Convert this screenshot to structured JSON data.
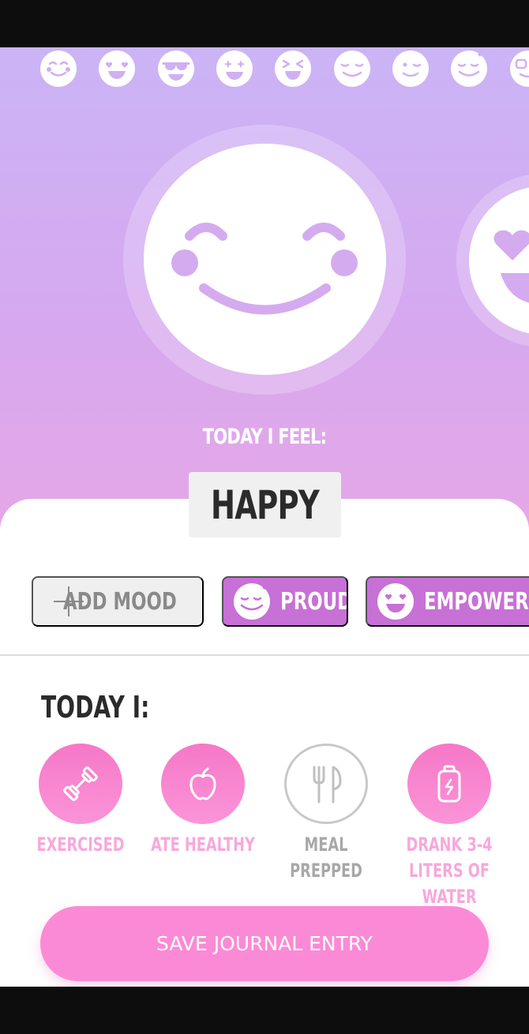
{
  "mood_strip": {
    "icons": [
      "smiling-face-icon",
      "heart-eyes-icon",
      "sunglasses-face-icon",
      "star-eyes-icon",
      "laughing-face-icon",
      "content-face-icon",
      "winking-face-icon",
      "proud-face-icon",
      "nerd-face-icon"
    ]
  },
  "current_mood": {
    "prompt": "TODAY I FEEL:",
    "name": "HAPPY",
    "icon": "happy-face-icon",
    "next_icon": "heart-eyes-icon"
  },
  "mood_chips": {
    "add_label": "ADD MOOD",
    "items": [
      {
        "label": "PROUD",
        "icon": "proud-face-icon"
      },
      {
        "label": "EMPOWERED",
        "icon": "heart-eyes-icon"
      }
    ]
  },
  "today": {
    "label": "TODAY I:",
    "habits": [
      {
        "label": "EXERCISED",
        "icon": "dumbbell-icon",
        "selected": true
      },
      {
        "label": "ATE HEALTHY",
        "icon": "apple-icon",
        "selected": true
      },
      {
        "label": "MEAL PREPPED",
        "icon": "fork-knife-icon",
        "selected": false
      },
      {
        "label": "DRANK 3-4 LITERS OF WATER",
        "icon": "water-bottle-icon",
        "selected": true
      }
    ]
  },
  "save_button": {
    "label": "SAVE JOURNAL ENTRY"
  },
  "colors": {
    "hero_top": "#cbb4f6",
    "hero_bottom": "#e7a7e6",
    "mood_chip": "#c770d6",
    "habit_active": "#f578c8",
    "save_button": "#fb8ad6"
  }
}
